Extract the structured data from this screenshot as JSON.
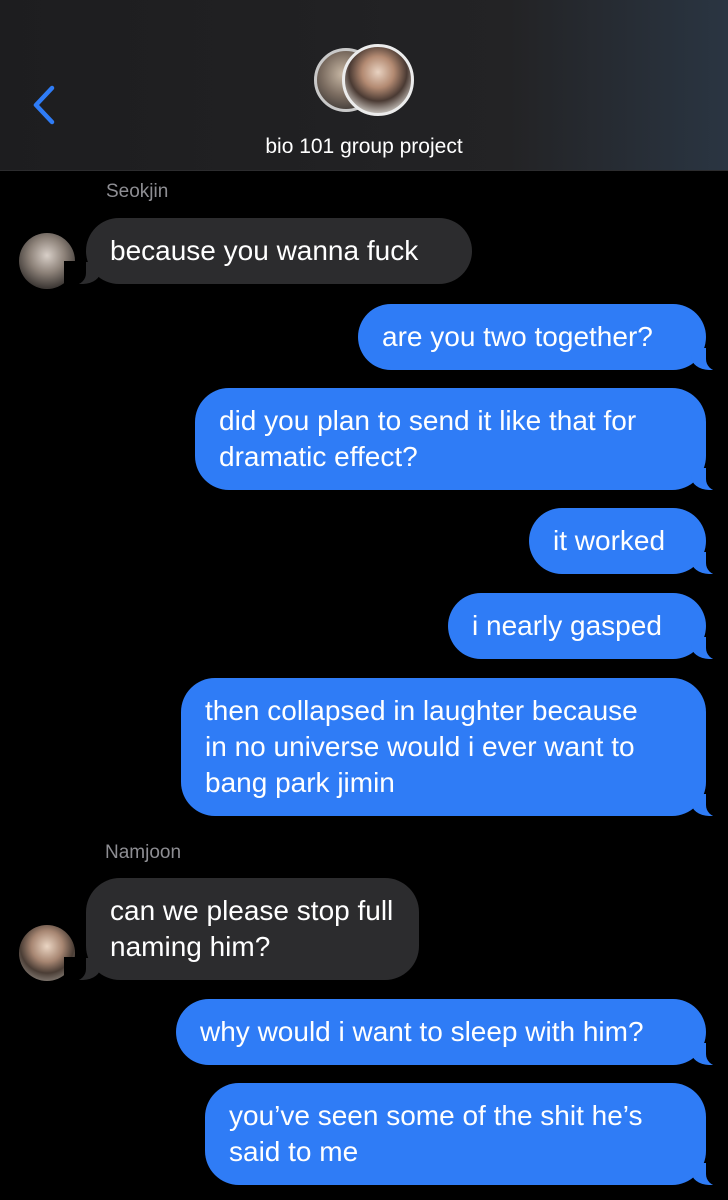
{
  "header": {
    "group_name": "bio 101 group project",
    "back_icon": "chevron-left-icon",
    "accent_color": "#2f7cf6"
  },
  "senders": {
    "seokjin": "Seokjin",
    "namjoon": "Namjoon"
  },
  "messages": [
    {
      "from": "Seokjin",
      "direction": "incoming",
      "text": "because you wanna fuck"
    },
    {
      "from": "me",
      "direction": "outgoing",
      "text": "are you two together?"
    },
    {
      "from": "me",
      "direction": "outgoing",
      "text": "did you plan to send it like that for\ndramatic effect?"
    },
    {
      "from": "me",
      "direction": "outgoing",
      "text": "it worked"
    },
    {
      "from": "me",
      "direction": "outgoing",
      "text": "i nearly gasped"
    },
    {
      "from": "me",
      "direction": "outgoing",
      "text": "then collapsed in laughter because\nin no universe would i ever want to\nbang park jimin"
    },
    {
      "from": "Namjoon",
      "direction": "incoming",
      "text": "can we please stop full\nnaming him?"
    },
    {
      "from": "me",
      "direction": "outgoing",
      "text": "why would i want to sleep with him?"
    },
    {
      "from": "me",
      "direction": "outgoing",
      "text": "you’ve seen some of the shit he’s\nsaid to me"
    }
  ],
  "colors": {
    "incoming_bubble": "#2c2c2e",
    "outgoing_bubble": "#2f7cf6",
    "background": "#000000",
    "sender_name": "#8e8e93"
  }
}
